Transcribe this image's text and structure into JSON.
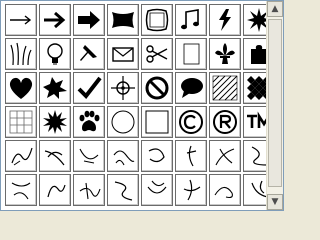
{
  "shape_picker": {
    "scrollbar": {
      "up_glyph": "▲",
      "down_glyph": "▼"
    },
    "rows": [
      [
        "thin-arrow-icon",
        "arrow-icon",
        "bold-arrow-icon",
        "banner-icon",
        "stamp-frame-icon",
        "music-notes-icon",
        "lightning-icon",
        "starburst-icon"
      ],
      [
        "grass-icon",
        "light-bulb-icon",
        "pushpin-icon",
        "envelope-icon",
        "scissors-icon",
        "blank-page-icon",
        "fleur-de-lis-icon",
        "puzzle-piece-icon"
      ],
      [
        "heart-icon",
        "splat-icon",
        "checkmark-icon",
        "crosshair-icon",
        "no-symbol-icon",
        "speech-bubble-icon",
        "diagonal-grid-icon",
        "diamond-pattern-icon"
      ],
      [
        "tile-grid-icon",
        "explosion-icon",
        "paw-print-icon",
        "circle-frame-icon",
        "square-frame-icon",
        "copyright-icon",
        "registered-icon",
        "trademark-icon"
      ],
      [
        "scribble-shape-1-icon",
        "scribble-shape-2-icon",
        "scribble-shape-3-icon",
        "scribble-shape-4-icon",
        "scribble-shape-5-icon",
        "scribble-shape-6-icon",
        "scribble-shape-7-icon",
        "scribble-shape-8-icon"
      ],
      [
        "scribble-shape-9-icon",
        "scribble-shape-10-icon",
        "scribble-shape-11-icon",
        "scribble-shape-12-icon",
        "scribble-shape-13-icon",
        "scribble-shape-14-icon",
        "scribble-shape-15-icon",
        "scribble-shape-16-icon"
      ]
    ]
  }
}
